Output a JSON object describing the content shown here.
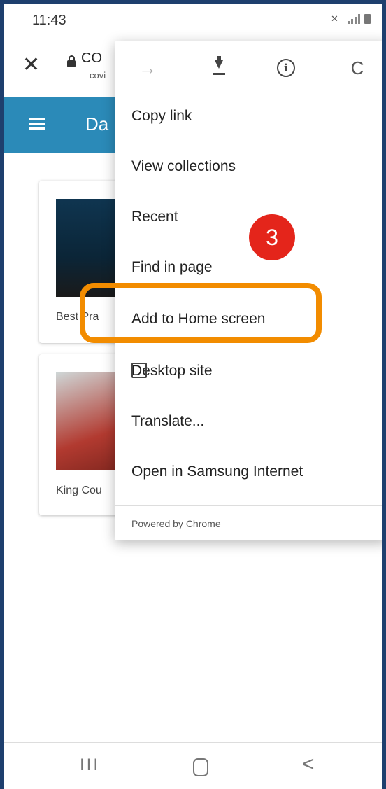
{
  "status_bar": {
    "time": "11:43"
  },
  "url_bar": {
    "title": "CO",
    "subtitle": "covi"
  },
  "app_header": {
    "title": "Da"
  },
  "cards": [
    {
      "label": "Best Pra"
    },
    {
      "label": "King Cou"
    }
  ],
  "menu": {
    "toolbar": {
      "forward": "→",
      "refresh": "C"
    },
    "items": [
      {
        "label": "Copy link"
      },
      {
        "label": "View collections"
      },
      {
        "label": "Recent"
      },
      {
        "label": "Find in page"
      },
      {
        "label": "Add to Home screen"
      },
      {
        "label": "Desktop site"
      },
      {
        "label": "Translate..."
      },
      {
        "label": "Open in Samsung Internet"
      }
    ],
    "footer": "Powered by Chrome"
  },
  "callout": {
    "step": "3",
    "highlight_color": "#f28c00",
    "badge_color": "#e4251b"
  },
  "nav": {
    "recents": "III",
    "back": "<"
  }
}
